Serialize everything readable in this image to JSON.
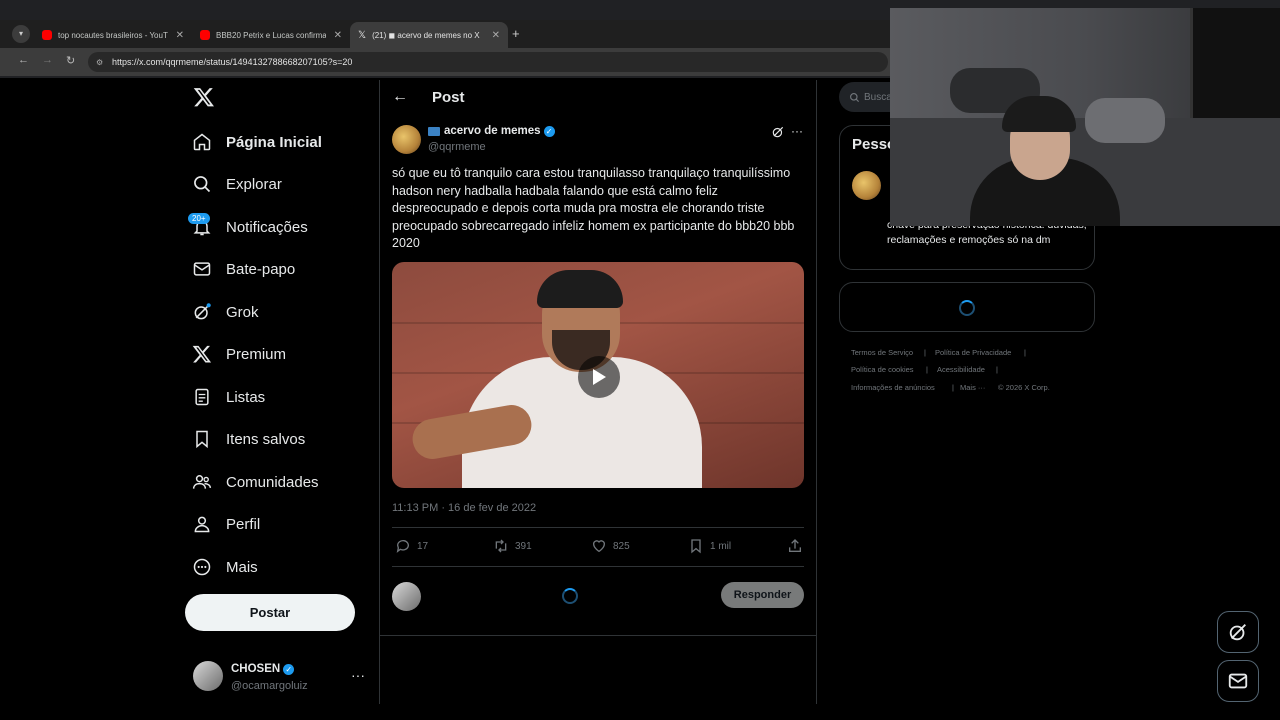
{
  "browser": {
    "tabs": [
      {
        "label": "top nocautes brasileiros - YouT",
        "favicon": "youtube"
      },
      {
        "label": "BBB20 Petrix e Lucas confirmar",
        "favicon": "youtube"
      },
      {
        "label": "(21) ◼ acervo de memes no X",
        "favicon": "x"
      }
    ],
    "url": "https://x.com/qqrmeme/status/1494132788668207105?s=20"
  },
  "sidebar": {
    "items": [
      {
        "label": "Página Inicial",
        "icon": "home-icon"
      },
      {
        "label": "Explorar",
        "icon": "search-icon"
      },
      {
        "label": "Notificações",
        "icon": "bell-icon"
      },
      {
        "label": "Bate-papo",
        "icon": "mail-icon"
      },
      {
        "label": "Grok",
        "icon": "grok-icon"
      },
      {
        "label": "Premium",
        "icon": "x-logo-icon"
      },
      {
        "label": "Listas",
        "icon": "list-icon"
      },
      {
        "label": "Itens salvos",
        "icon": "bookmark-icon"
      },
      {
        "label": "Comunidades",
        "icon": "people-icon"
      },
      {
        "label": "Perfil",
        "icon": "person-icon"
      },
      {
        "label": "Mais",
        "icon": "more-circle-icon"
      }
    ],
    "notifications_badge": "20+",
    "post_label": "Postar",
    "account": {
      "name": "CHOSEN",
      "handle": "@ocamargoluiz"
    }
  },
  "main": {
    "header_title": "Post",
    "author": {
      "name": "acervo de memes",
      "handle": "@qqrmeme"
    },
    "text": "só que eu tô tranquilo cara estou tranquilasso tranquilaço tranquilíssimo hadson nery hadballa hadbala falando que está calmo feliz despreocupado e depois corta muda pra mostra ele chorando triste preocupado sobrecarregado infeliz homem ex participante do bbb20 bbb 2020",
    "timestamp": "11:13 PM · 16 de fev de 2022",
    "stats": {
      "replies": "17",
      "reposts": "391",
      "likes": "825",
      "bookmarks": "1 mil"
    },
    "reply_label": "Responder"
  },
  "right": {
    "search_placeholder": "Buscar",
    "people_title": "Pessoas",
    "bio": "chave para preservação histórica. dúvidas, reclamações e remoções só na dm",
    "footer": [
      "Termos de Serviço",
      "Política de Privacidade",
      "Política de cookies",
      "Acessibilidade",
      "Informações de anúncios",
      "Mais ···",
      "© 2026 X Corp."
    ]
  },
  "colors": {
    "accent": "#1d9bf0",
    "background": "#000000",
    "text": "#e7e9ea",
    "muted": "#71767b"
  }
}
